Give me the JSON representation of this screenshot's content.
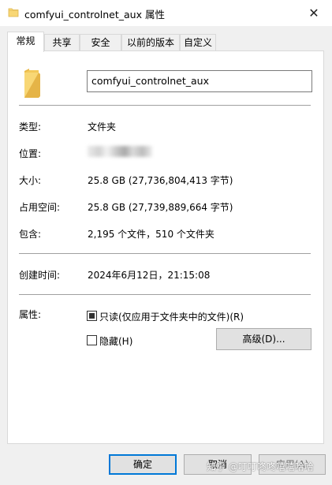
{
  "window": {
    "title": "comfyui_controlnet_aux 属性",
    "close_glyph": "✕"
  },
  "tabs": [
    {
      "label": "常规",
      "active": true
    },
    {
      "label": "共享"
    },
    {
      "label": "安全"
    },
    {
      "label": "以前的版本"
    },
    {
      "label": "自定义"
    }
  ],
  "general": {
    "name_value": "comfyui_controlnet_aux",
    "type_label": "类型:",
    "type_value": "文件夹",
    "location_label": "位置:",
    "size_label": "大小:",
    "size_value": "25.8 GB (27,736,804,413 字节)",
    "disk_size_label": "占用空间:",
    "disk_size_value": "25.8 GB (27,739,889,664 字节)",
    "contains_label": "包含:",
    "contains_value": "2,195 个文件，510 个文件夹",
    "created_label": "创建时间:",
    "created_value": "2024年6月12日，21:15:08",
    "attributes_label": "属性:",
    "readonly_label": "只读(仅应用于文件夹中的文件)(R)",
    "readonly_checked": true,
    "hidden_label": "隐藏(H)",
    "hidden_checked": false,
    "advanced_label": "高级(D)..."
  },
  "footer": {
    "ok_label": "确定",
    "cancel_label": "取消",
    "apply_label": "应用(A)",
    "watermark": "知乎 @叮叮咚咚嘻嘻哈哈"
  },
  "colors": {
    "folder": "#f8d775",
    "focus": "#0078d7"
  }
}
